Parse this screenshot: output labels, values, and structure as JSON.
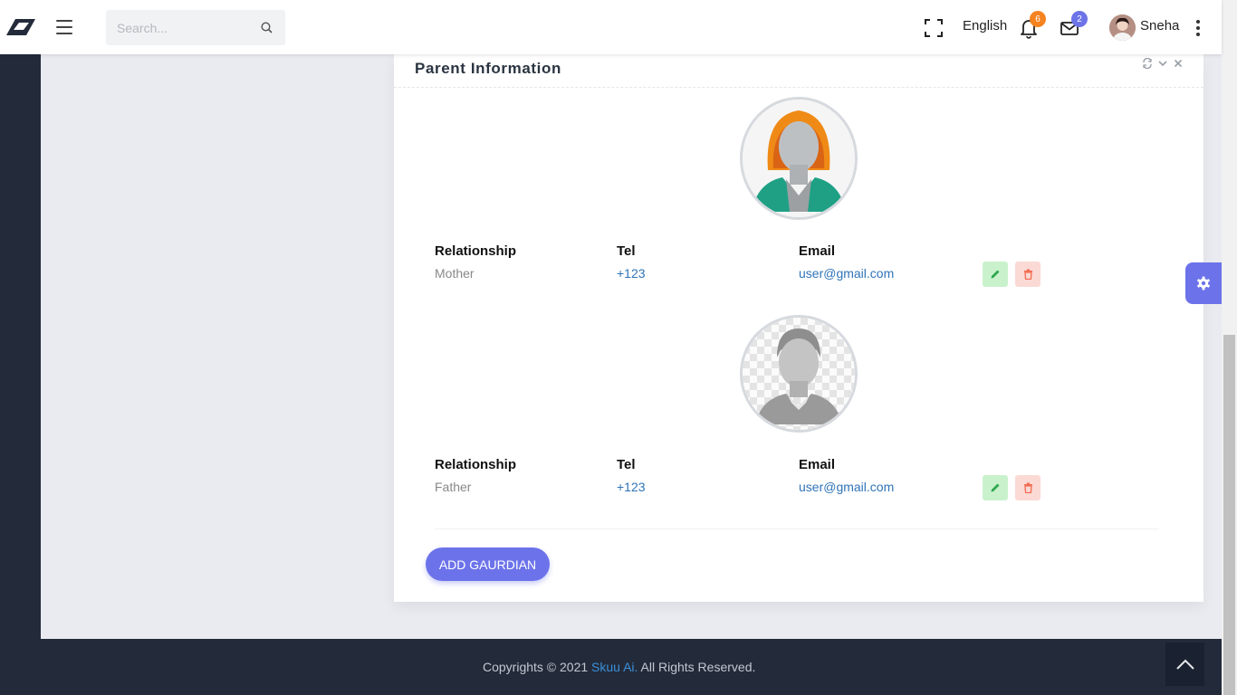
{
  "header": {
    "search_placeholder": "Search...",
    "language": "English",
    "notifications_count": "6",
    "messages_count": "2",
    "username": "Sneha"
  },
  "card": {
    "title": "Parent Information",
    "parents": [
      {
        "relationship_label": "Relationship",
        "relationship": "Mother",
        "tel_label": "Tel",
        "tel": "+123",
        "email_label": "Email",
        "email": "user@gmail.com"
      },
      {
        "relationship_label": "Relationship",
        "relationship": "Father",
        "tel_label": "Tel",
        "tel": "+123",
        "email_label": "Email",
        "email": "user@gmail.com"
      }
    ],
    "add_button": "ADD GAURDIAN"
  },
  "footer": {
    "prefix": "Copyrights © 2021 ",
    "brand": "Skuu Ai.",
    "suffix": " All Rights Reserved."
  },
  "colors": {
    "accent": "#6c73ea",
    "sidebar": "#232b3a",
    "link": "#2f73b8",
    "badge_orange": "#f5831f",
    "edit_bg": "#c9f2cc",
    "delete_bg": "#fbd9d4"
  },
  "icons": [
    "logo-icon",
    "menu-icon",
    "search-icon",
    "fullscreen-icon",
    "bell-icon",
    "mail-icon",
    "kebab-icon",
    "refresh-icon",
    "chevron-down-icon",
    "close-icon",
    "pencil-icon",
    "trash-icon",
    "gear-icon",
    "chevron-up-icon"
  ]
}
